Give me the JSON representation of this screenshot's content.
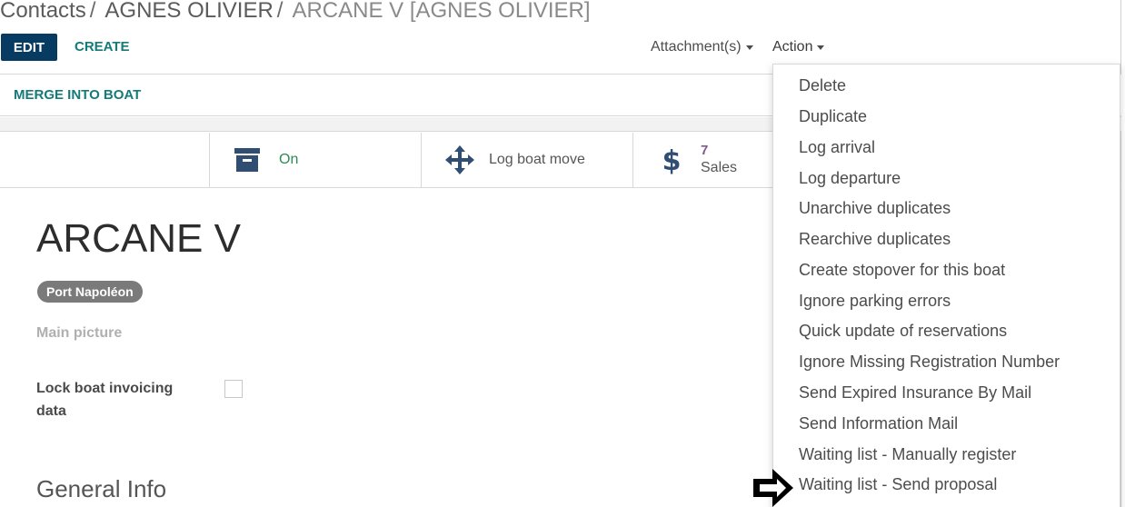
{
  "breadcrumb": {
    "items": [
      "Contacts",
      "AGNES OLIVIER",
      "ARCANE V [AGNES OLIVIER]"
    ],
    "separator": "/"
  },
  "controls": {
    "edit_label": "EDIT",
    "create_label": "CREATE",
    "attachments_label": "Attachment(s)",
    "action_label": "Action"
  },
  "statusbar": {
    "merge_label": "MERGE INTO BOAT"
  },
  "button_box": {
    "archive": {
      "label": "On",
      "icon": "archive-icon"
    },
    "move": {
      "label": "Log boat move",
      "icon": "arrows-move-icon"
    },
    "sales": {
      "value": "7",
      "label": "Sales",
      "icon": "dollar-icon"
    }
  },
  "form": {
    "title": "ARCANE V",
    "tag": "Port Napoléon",
    "main_picture_label": "Main picture",
    "lock_invoicing_label": "Lock boat invoicing data",
    "lock_invoicing_checked": false,
    "section_title": "General Info"
  },
  "action_menu": {
    "items": [
      "Delete",
      "Duplicate",
      "Log arrival",
      "Log departure",
      "Unarchive duplicates",
      "Rearchive duplicates",
      "Create stopover for this boat",
      "Ignore parking errors",
      "Quick update of reservations",
      "Ignore Missing Registration Number",
      "Send Expired Insurance By Mail",
      "Send Information Mail",
      "Waiting list - Manually register",
      "Waiting list - Send proposal"
    ]
  },
  "colors": {
    "primary": "#073b62",
    "link": "#157a7a",
    "stat_value": "#7d5a8a",
    "icon": "#2f4e72",
    "tag_bg": "#7a7a7a"
  }
}
